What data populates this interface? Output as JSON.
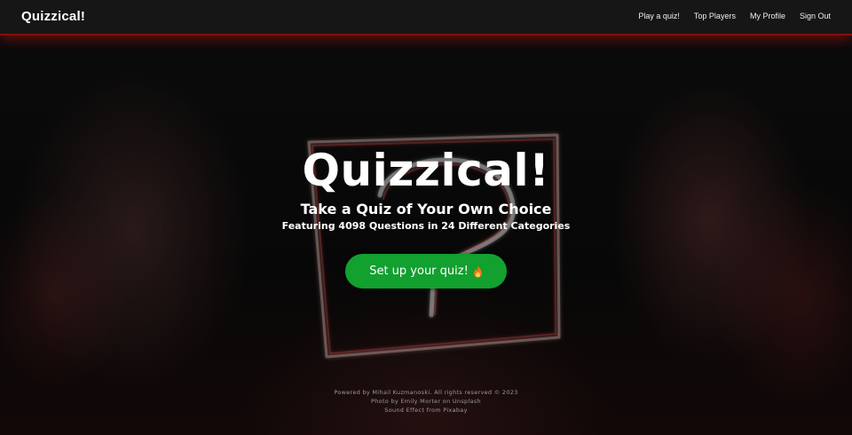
{
  "navbar": {
    "brand": "Quizzical!",
    "links": [
      {
        "label": "Play a quiz!"
      },
      {
        "label": "Top Players"
      },
      {
        "label": "My Profile"
      },
      {
        "label": "Sign Out"
      }
    ]
  },
  "hero": {
    "title": "Quizzical!",
    "subtitle": "Take a Quiz of Your Own Choice",
    "tagline": "Featuring 4098 Questions in 24 Different Categories",
    "cta_label": "Set up your quiz!",
    "cta_icon": "flame-icon"
  },
  "footer": {
    "line1": "Powered by Mihail Kuzmanoski. All rights reserved © 2023",
    "line2": "Photo by Emily Morter on Unsplash",
    "line3": "Sound Effect from Pixabay"
  },
  "colors": {
    "accent_green": "#12a02f",
    "navbar_bg": "#161616",
    "navbar_glow": "#8a0d0d"
  }
}
